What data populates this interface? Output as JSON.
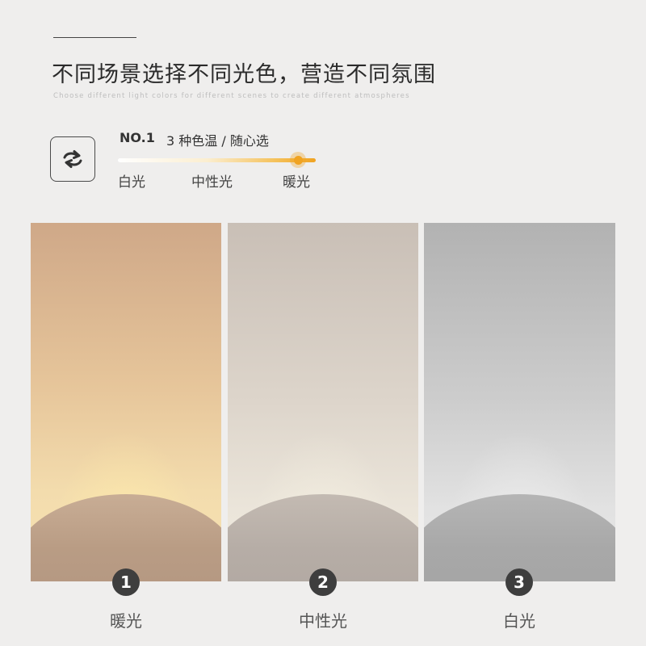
{
  "header": {
    "title": "不同场景选择不同光色，营造不同氛围",
    "subtitle": "Choose different light colors for different scenes to create different atmospheres"
  },
  "feature": {
    "icon": "switch-arrows-icon",
    "number": "NO.1",
    "text": "3 种色温 / 随心选",
    "slider": {
      "labels": [
        "白光",
        "中性光",
        "暖光"
      ],
      "selected": "暖光",
      "colors": {
        "start": "#ffffff",
        "end": "#f0a321"
      }
    }
  },
  "panels": [
    {
      "number": "1",
      "label": "暖光"
    },
    {
      "number": "2",
      "label": "中性光"
    },
    {
      "number": "3",
      "label": "白光"
    }
  ]
}
